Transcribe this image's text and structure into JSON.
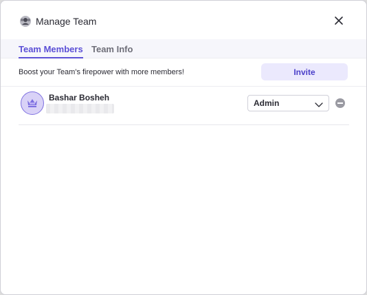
{
  "dialog": {
    "title": "Manage Team",
    "header_icon": "team-icon",
    "close_icon": "close-icon"
  },
  "tabs": [
    {
      "label": "Team Members",
      "active": true
    },
    {
      "label": "Team Info",
      "active": false
    }
  ],
  "promo": {
    "text": "Boost your Team's firepower with more members!",
    "invite_label": "Invite"
  },
  "members": [
    {
      "name": "Bashar Bosheh",
      "email": "",
      "role": "Admin",
      "avatar_icon": "crown-icon"
    }
  ],
  "colors": {
    "accent": "#5b4fd6",
    "invite_bg": "#ebe9fd",
    "avatar_bg": "#d9d2f7"
  }
}
